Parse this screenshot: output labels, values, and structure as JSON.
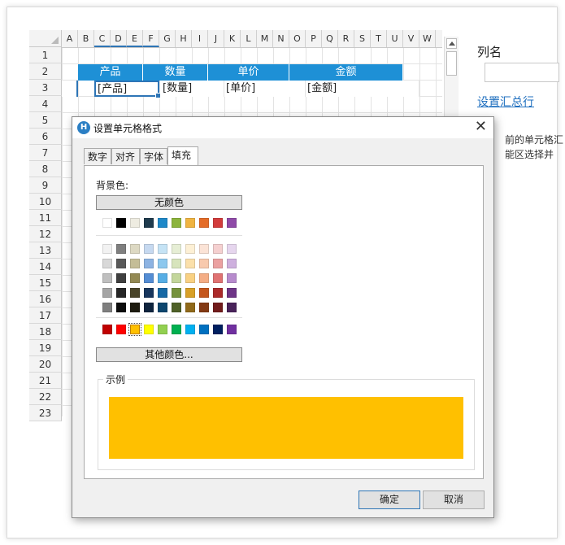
{
  "spreadsheet": {
    "columns": [
      "A",
      "B",
      "C",
      "D",
      "E",
      "F",
      "G",
      "H",
      "I",
      "J",
      "K",
      "L",
      "M",
      "N",
      "O",
      "P",
      "Q",
      "R",
      "S",
      "T",
      "U",
      "V",
      "W"
    ],
    "rows": [
      "1",
      "2",
      "3",
      "4",
      "5",
      "6",
      "7",
      "8",
      "9",
      "10",
      "11",
      "12",
      "13",
      "14",
      "15",
      "16",
      "17",
      "18",
      "19",
      "20",
      "21",
      "22",
      "23"
    ],
    "header_cells": [
      "产品",
      "数量",
      "单价",
      "金额"
    ],
    "row3_cells": [
      "[产品]",
      "[数量]",
      "[单价]",
      "[金额]"
    ],
    "header_color": "#1e90d6"
  },
  "right_panel": {
    "column_name_label": "列名",
    "column_name_value": "",
    "summary_link": "设置汇总行",
    "hint_line1": "前的单元格汇",
    "hint_line2": "能区选择并"
  },
  "dialog": {
    "title": "设置单元格格式",
    "close_icon": "close-icon",
    "tabs": [
      "数字",
      "对齐",
      "字体",
      "填充"
    ],
    "active_tab": "填充",
    "background_label": "背景色:",
    "no_color_button": "无颜色",
    "more_colors_button": "其他颜色...",
    "sample_label": "示例",
    "selected_color": "#ffc000",
    "theme_top_row": [
      "#ffffff",
      "#000000",
      "#eeece1",
      "#1f3b4d",
      "#1e88c8",
      "#8cb43c",
      "#f0b441",
      "#e46c28",
      "#d23c3c",
      "#8f4aa8"
    ],
    "theme_shades": [
      [
        "#f2f2f2",
        "#7f7f7f",
        "#ddd9c3",
        "#c6d9f0",
        "#c5e3f5",
        "#e6eed5",
        "#fdf0d5",
        "#fbe3d6",
        "#f5d0d0",
        "#e6d6ee"
      ],
      [
        "#d8d8d8",
        "#595959",
        "#c4bd97",
        "#8db3e2",
        "#8dc8ee",
        "#d7e4bc",
        "#fbe0ab",
        "#f8c9ad",
        "#eba1a1",
        "#ceb0de"
      ],
      [
        "#bfbfbf",
        "#3f3f3f",
        "#938953",
        "#548dd4",
        "#57aee5",
        "#c3d69b",
        "#f9d183",
        "#f4ad85",
        "#e07272",
        "#b78bcd"
      ],
      [
        "#a5a5a5",
        "#262626",
        "#494429",
        "#17365d",
        "#1769a5",
        "#76923c",
        "#d8a027",
        "#c4561c",
        "#ab2a2a",
        "#6e3587"
      ],
      [
        "#7f7f7f",
        "#0c0c0c",
        "#1d1b10",
        "#0f243e",
        "#0d466e",
        "#4f6128",
        "#90691a",
        "#833913",
        "#721c1c",
        "#49235a"
      ]
    ],
    "standard_colors": [
      "#c00000",
      "#ff0000",
      "#ffc000",
      "#ffff00",
      "#92d050",
      "#00b050",
      "#00b0f0",
      "#0070c0",
      "#002060",
      "#7030a0"
    ],
    "ok_button": "确定",
    "cancel_button": "取消"
  }
}
